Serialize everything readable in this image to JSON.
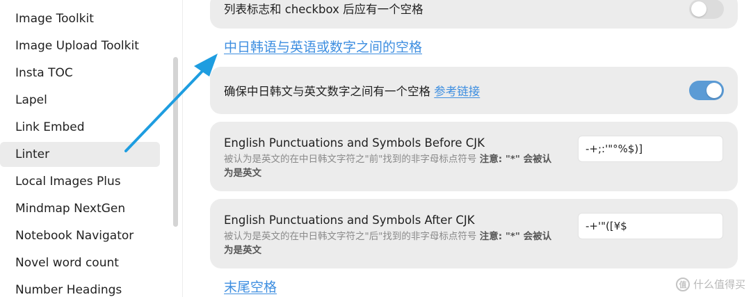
{
  "sidebar": {
    "items": [
      {
        "label": "Image Toolkit"
      },
      {
        "label": "Image Upload Toolkit"
      },
      {
        "label": "Insta TOC"
      },
      {
        "label": "Lapel"
      },
      {
        "label": "Link Embed"
      },
      {
        "label": "Linter",
        "active": true
      },
      {
        "label": "Local Images Plus"
      },
      {
        "label": "Mindmap NextGen"
      },
      {
        "label": "Notebook Navigator"
      },
      {
        "label": "Novel word count"
      },
      {
        "label": "Number Headings"
      }
    ]
  },
  "main": {
    "top_setting": {
      "title": "列表标志和 checkbox 后应有一个空格",
      "enabled": false
    },
    "section_cjk": {
      "label": "中日韩语与英语或数字之间的空格"
    },
    "space_setting": {
      "title": "确保中日韩文与英文数字之间有一个空格",
      "ref_link": "参考链接",
      "enabled": true
    },
    "before_setting": {
      "title": "English Punctuations and Symbols Before CJK",
      "desc_prefix": "被认为是英文的在中日韩文字符之\"前\"找到的非字母标点符号 ",
      "desc_note_label": "注意: \"*\" 会被认为是英文",
      "value": "-+;:'\"°%$)]"
    },
    "after_setting": {
      "title": "English Punctuations and Symbols After CJK",
      "desc_prefix": "被认为是英文的在中日韩文字符之\"后\"找到的非字母标点符号 ",
      "desc_note_label": "注意: \"*\" 会被认为是英文",
      "value": "-+'\"([¥$"
    },
    "section_trailing": {
      "label": "末尾空格"
    }
  },
  "annotation": {
    "arrow_color": "#1e9de0"
  },
  "watermark": {
    "logo_char": "值",
    "text": "什么值得买"
  },
  "colors": {
    "accent": "#3d8ee0",
    "toggle_on": "#5b9bd5",
    "card_bg": "#ececec",
    "active_item_bg": "#ebebeb"
  }
}
